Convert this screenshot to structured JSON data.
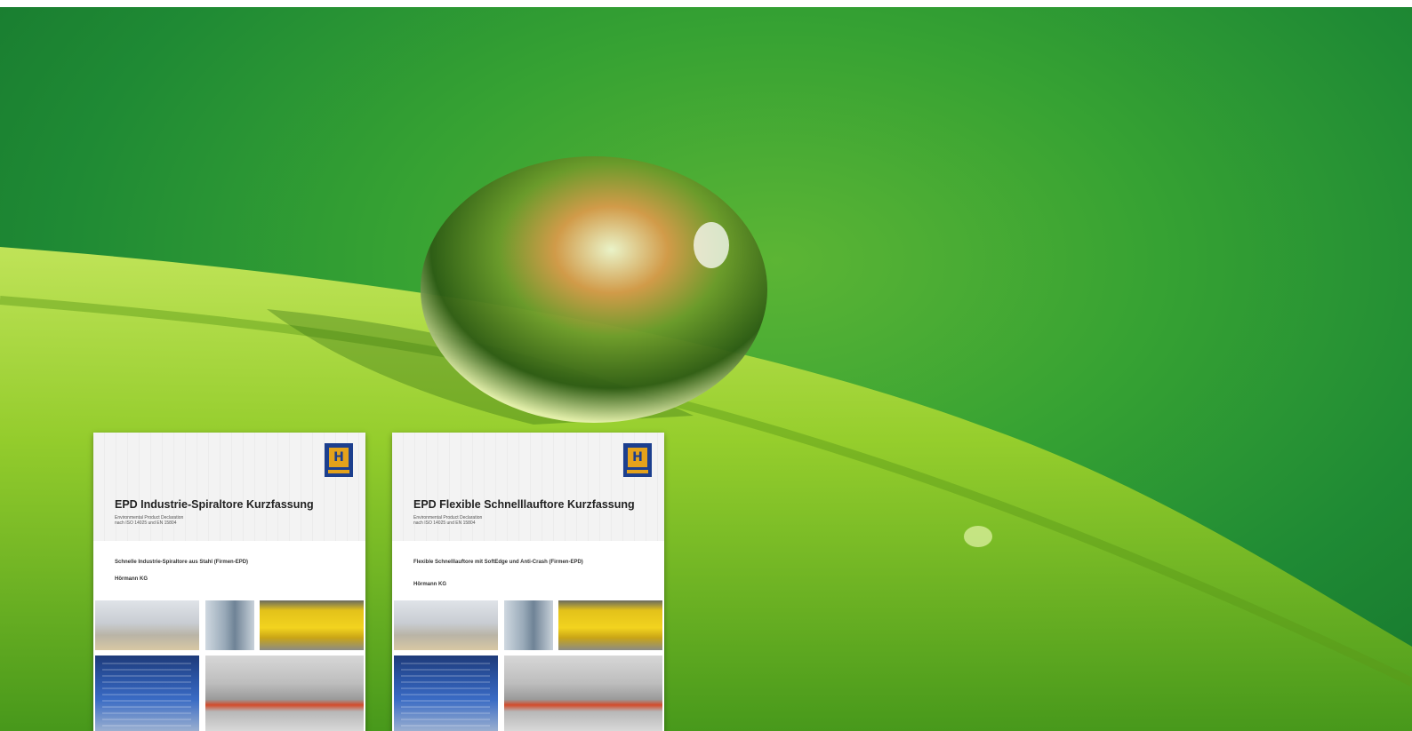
{
  "brochures": [
    {
      "title": "EPD Industrie-Spiraltore Kurzfassung",
      "subtitle_line1": "Environmental Product Declaration",
      "subtitle_line2": "nach ISO 14025 und EN 15804",
      "description": "Schnelle Industrie-Spiraltore aus Stahl (Firmen-EPD)",
      "company": "Hörmann KG"
    },
    {
      "title": "EPD Flexible Schnelllauftore Kurzfassung",
      "subtitle_line1": "Environmental Product Declaration",
      "subtitle_line2": "nach ISO 14025 und EN 15804",
      "description": "Flexible Schnelllauftore mit SoftEdge und Anti-Crash (Firmen-EPD)",
      "company": "Hörmann KG"
    }
  ],
  "colors": {
    "background_green": "#36a233",
    "leaf_green": "#9ad02c",
    "logo_blue": "#1c3f8e",
    "logo_yellow": "#e4a21b"
  }
}
